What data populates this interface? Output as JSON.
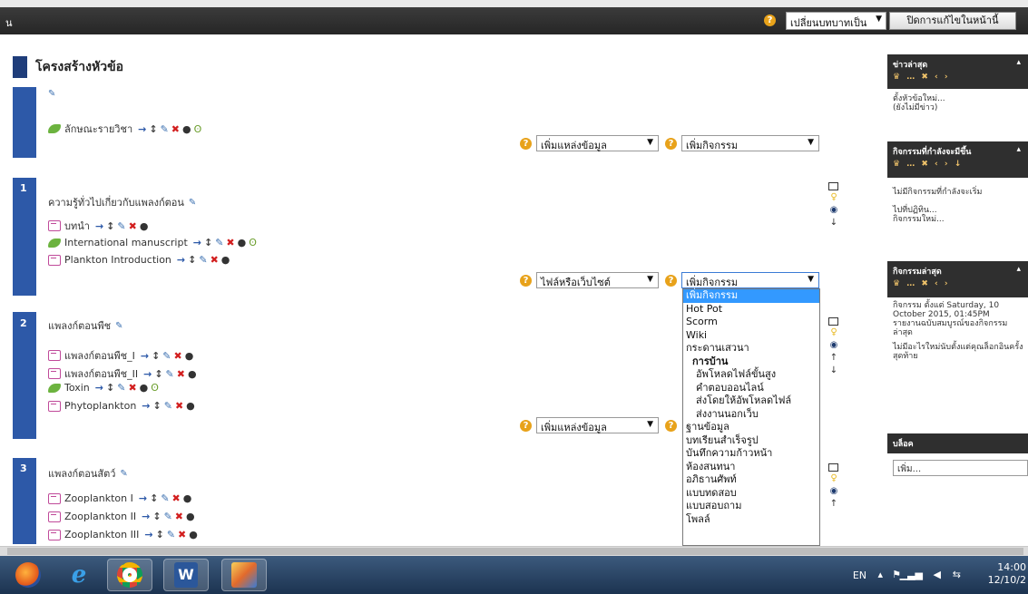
{
  "topbar": {
    "brand": "น",
    "help": "?",
    "role_select": "เปลี่ยนบทบาทเป็น",
    "edit_button": "ปิดการแก้ไขในหน้านี้"
  },
  "main": {
    "heading": "โครงสร้างหัวข้อ",
    "section0": {
      "row1": "ลักษณะรายวิชา",
      "select_resource": "เพิ่มแหล่งข้อมูล",
      "select_activity": "เพิ่มกิจกรรม"
    },
    "section1": {
      "num": "1",
      "title": "ความรู้ทั่วไปเกี่ยวกับแพลงก์ตอน",
      "items": [
        "บทนำ",
        "International manuscript",
        "Plankton Introduction"
      ],
      "select_resource": "ไฟล์หรือเว็บไซต์",
      "select_activity": "เพิ่มกิจกรรม"
    },
    "section2": {
      "num": "2",
      "title": "แพลงก์ตอนพืช",
      "items": [
        "แพลงก์ตอนพืช_I",
        "แพลงก์ตอนพืช_II",
        "Toxin",
        "Phytoplankton"
      ],
      "select_resource": "เพิ่มแหล่งข้อมูล"
    },
    "section3": {
      "num": "3",
      "title": "แพลงก์ตอนสัตว์",
      "items": [
        "Zooplankton I",
        "Zooplankton II",
        "Zooplankton III"
      ]
    }
  },
  "dropdown": {
    "options": [
      {
        "label": "เพิ่มกิจกรรม",
        "kind": "selected"
      },
      {
        "label": "Hot Pot",
        "kind": "opt"
      },
      {
        "label": "Scorm",
        "kind": "opt"
      },
      {
        "label": "Wiki",
        "kind": "opt"
      },
      {
        "label": "กระดานเสวนา",
        "kind": "opt"
      },
      {
        "label": "การบ้าน",
        "kind": "group"
      },
      {
        "label": "อัพโหลดไฟล์ขั้นสูง",
        "kind": "sub"
      },
      {
        "label": "คำตอบออนไลน์",
        "kind": "sub"
      },
      {
        "label": "ส่งโดยให้อัพโหลดไฟล์",
        "kind": "sub"
      },
      {
        "label": "ส่งงานนอกเว็บ",
        "kind": "sub"
      },
      {
        "label": "ฐานข้อมูล",
        "kind": "opt"
      },
      {
        "label": "บทเรียนสำเร็จรูป",
        "kind": "opt"
      },
      {
        "label": "บันทึกความก้าวหน้า",
        "kind": "opt"
      },
      {
        "label": "ห้องสนทนา",
        "kind": "opt"
      },
      {
        "label": "อภิธานศัพท์",
        "kind": "opt"
      },
      {
        "label": "แบบทดสอบ",
        "kind": "opt"
      },
      {
        "label": "แบบสอบถาม",
        "kind": "opt"
      },
      {
        "label": "โพลล์",
        "kind": "opt"
      }
    ]
  },
  "sidebar": {
    "news": {
      "title": "ข่าวล่าสุด",
      "line1": "ตั้งหัวข้อใหม่...",
      "line2": "(ยังไม่มีข่าว)"
    },
    "upcoming": {
      "title": "กิจกรรมที่กำลังจะมีขึ้น",
      "line1": "ไม่มีกิจกรรมที่กำลังจะเริ่ม",
      "line2": "ไปที่ปฏิทิน...",
      "line3": "กิจกรรมใหม่..."
    },
    "recent": {
      "title": "กิจกรรมล่าสุด",
      "line1": "กิจกรรม ตั้งแต่ Saturday, 10 October 2015, 01:45PM",
      "line2": "รายงานฉบับสมบูรณ์ของกิจกรรมล่าสุด",
      "line3": "ไม่มีอะไรใหม่นับตั้งแต่คุณล็อกอินครั้งสุดท้าย"
    },
    "blocks": {
      "title": "บล็อค",
      "input": "เพิ่ม..."
    }
  },
  "taskbar": {
    "lang": "EN",
    "time": "14:00",
    "date": "12/10/2"
  }
}
